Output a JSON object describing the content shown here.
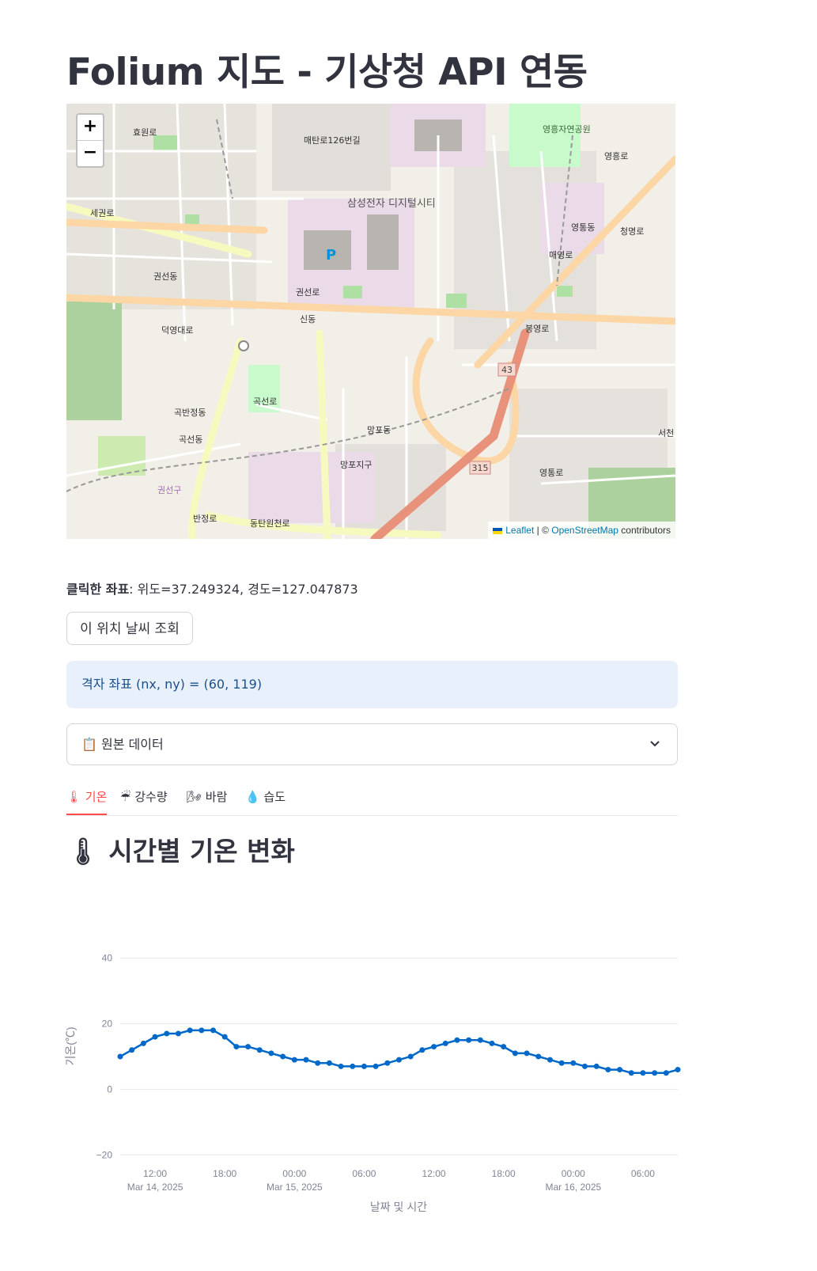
{
  "page": {
    "title": "Folium 지도 - 기상청 API 연동"
  },
  "map": {
    "zoom_in": "+",
    "zoom_out": "−",
    "labels": [
      "효원로",
      "매탄로126번길",
      "삼성전자 디지털시티",
      "영흥자연공원",
      "영통동",
      "권선동",
      "신동",
      "덕영대로",
      "망포동",
      "곡반정동",
      "망포지구",
      "세권로",
      "권선로",
      "봉영로",
      "매영로",
      "청명로",
      "곡선로",
      "동탄원천로",
      "영통로",
      "서천",
      "곡선동",
      "권선구",
      "반정로",
      "영흥로"
    ],
    "route_shields": [
      "43",
      "315"
    ],
    "parking": "P",
    "attribution": {
      "leaflet": "Leaflet",
      "sep": " | © ",
      "osm": "OpenStreetMap",
      "contrib": " contributors"
    }
  },
  "coords": {
    "label": "클릭한 좌표",
    "value": ": 위도=37.249324, 경도=127.047873"
  },
  "button": {
    "label": "이 위치 날씨 조회"
  },
  "info": {
    "text": "격자 좌표 (nx, ny) = (60, 119)"
  },
  "expander": {
    "label": "📋 원본 데이터"
  },
  "tabs": [
    {
      "label": "🌡 기온",
      "active": true
    },
    {
      "label": "☔ 강수량",
      "active": false
    },
    {
      "label": "🌬 바람",
      "active": false
    },
    {
      "label": "💧 습도",
      "active": false
    }
  ],
  "section": {
    "title": "🌡 시간별 기온 변화"
  },
  "colors": {
    "accent": "#ff4b4b",
    "series": "#0068c9",
    "info_bg": "#e8f1fb"
  },
  "chart_data": {
    "type": "line",
    "title": "",
    "xlabel": "날짜 및 시간",
    "ylabel": "기온(℃)",
    "ylim": [
      -25,
      45
    ],
    "yticks": [
      40,
      20,
      0,
      -20
    ],
    "ytick_labels": [
      "40",
      "20",
      "0",
      "−20"
    ],
    "grid": true,
    "legend": "none",
    "x_ticks": [
      {
        "time": "2025-03-14 12:00",
        "line1": "12:00",
        "line2": "Mar 14, 2025"
      },
      {
        "time": "2025-03-14 18:00",
        "line1": "18:00",
        "line2": ""
      },
      {
        "time": "2025-03-15 00:00",
        "line1": "00:00",
        "line2": "Mar 15, 2025"
      },
      {
        "time": "2025-03-15 06:00",
        "line1": "06:00",
        "line2": ""
      },
      {
        "time": "2025-03-15 12:00",
        "line1": "12:00",
        "line2": ""
      },
      {
        "time": "2025-03-15 18:00",
        "line1": "18:00",
        "line2": ""
      },
      {
        "time": "2025-03-16 00:00",
        "line1": "00:00",
        "line2": "Mar 16, 2025"
      },
      {
        "time": "2025-03-16 06:00",
        "line1": "06:00",
        "line2": ""
      }
    ],
    "x": [
      "2025-03-14 09:00",
      "2025-03-14 10:00",
      "2025-03-14 11:00",
      "2025-03-14 12:00",
      "2025-03-14 13:00",
      "2025-03-14 14:00",
      "2025-03-14 15:00",
      "2025-03-14 16:00",
      "2025-03-14 17:00",
      "2025-03-14 18:00",
      "2025-03-14 19:00",
      "2025-03-14 20:00",
      "2025-03-14 21:00",
      "2025-03-14 22:00",
      "2025-03-14 23:00",
      "2025-03-15 00:00",
      "2025-03-15 01:00",
      "2025-03-15 02:00",
      "2025-03-15 03:00",
      "2025-03-15 04:00",
      "2025-03-15 05:00",
      "2025-03-15 06:00",
      "2025-03-15 07:00",
      "2025-03-15 08:00",
      "2025-03-15 09:00",
      "2025-03-15 10:00",
      "2025-03-15 11:00",
      "2025-03-15 12:00",
      "2025-03-15 13:00",
      "2025-03-15 14:00",
      "2025-03-15 15:00",
      "2025-03-15 16:00",
      "2025-03-15 17:00",
      "2025-03-15 18:00",
      "2025-03-15 19:00",
      "2025-03-15 20:00",
      "2025-03-15 21:00",
      "2025-03-15 22:00",
      "2025-03-15 23:00",
      "2025-03-16 00:00",
      "2025-03-16 01:00",
      "2025-03-16 02:00",
      "2025-03-16 03:00",
      "2025-03-16 04:00",
      "2025-03-16 05:00",
      "2025-03-16 06:00",
      "2025-03-16 07:00",
      "2025-03-16 08:00",
      "2025-03-16 09:00"
    ],
    "series": [
      {
        "values": [
          10,
          12,
          14,
          16,
          17,
          17,
          18,
          18,
          18,
          16,
          13,
          13,
          12,
          11,
          10,
          9,
          9,
          8,
          8,
          7,
          7,
          7,
          7,
          8,
          9,
          10,
          12,
          13,
          14,
          15,
          15,
          15,
          14,
          13,
          11,
          11,
          10,
          9,
          8,
          8,
          7,
          7,
          6,
          6,
          5,
          5,
          5,
          5,
          6
        ]
      }
    ]
  }
}
